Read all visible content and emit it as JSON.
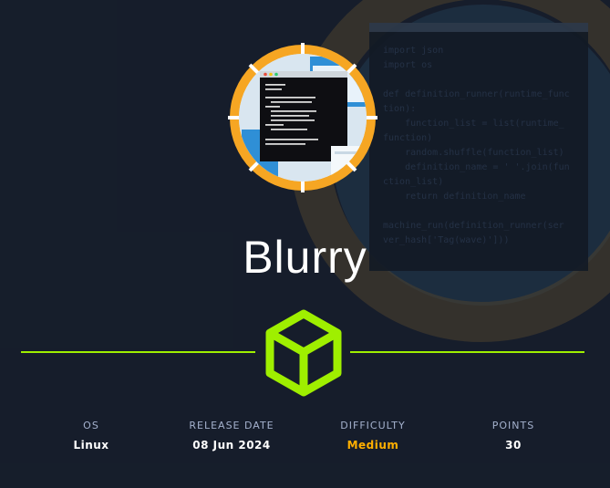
{
  "machine": {
    "name": "Blurry"
  },
  "stats": [
    {
      "label": "OS",
      "value": "Linux"
    },
    {
      "label": "RELEASE DATE",
      "value": "08 Jun 2024"
    },
    {
      "label": "DIFFICULTY",
      "value": "Medium"
    },
    {
      "label": "POINTS",
      "value": "30"
    }
  ],
  "colors": {
    "background": "#161e2b",
    "accent": "#9fef00",
    "difficulty_medium": "#ffaf00",
    "ring": "#f6a623",
    "label": "#a4b1cd"
  },
  "icons": {
    "logo": "terminal-window-avatar",
    "divider_icon": "cube-icon"
  }
}
